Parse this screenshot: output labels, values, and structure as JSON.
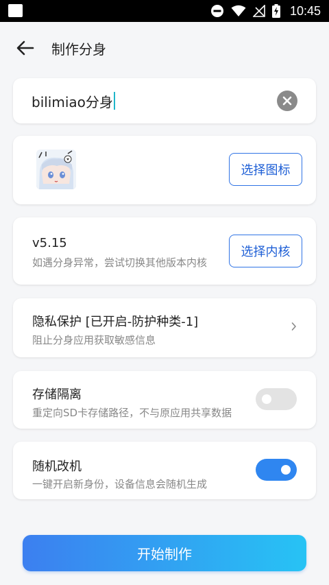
{
  "status_bar": {
    "time": "10:45"
  },
  "header": {
    "title": "制作分身"
  },
  "name_field": {
    "value": "bilimiao分身"
  },
  "icon_section": {
    "button_label": "选择图标"
  },
  "kernel_section": {
    "version": "v5.15",
    "hint": "如遇分身异常，尝试切换其他版本内核",
    "button_label": "选择内核"
  },
  "privacy_section": {
    "title": "隐私保护 [已开启-防护种类-1]",
    "subtitle": "阻止分身应用获取敏感信息"
  },
  "storage_section": {
    "title": "存储隔离",
    "subtitle": "重定向SD卡存储路径，不与原应用共享数据",
    "enabled": false
  },
  "random_section": {
    "title": "随机改机",
    "subtitle": "一键开启新身份，设备信息会随机生成",
    "enabled": true
  },
  "start_button": {
    "label": "开始制作"
  },
  "colors": {
    "accent": "#2f73e5",
    "toggle_on": "#2f86f0",
    "button_gradient_start": "#3c7ff0",
    "button_gradient_end": "#27c3f4"
  }
}
